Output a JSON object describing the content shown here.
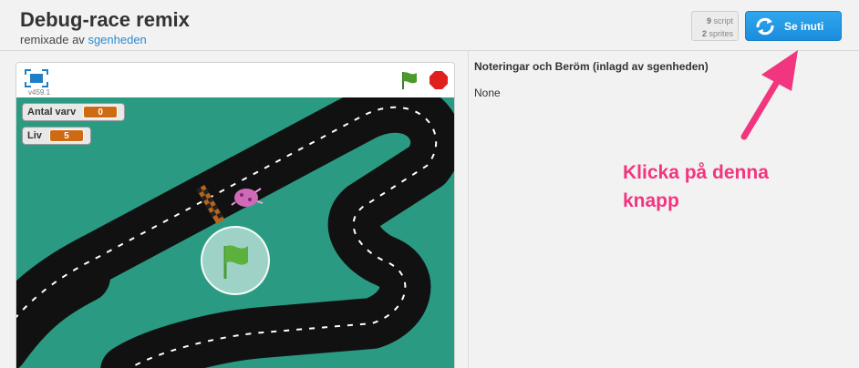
{
  "header": {
    "title": "Debug-race remix",
    "remixed_by_prefix": "remixade av",
    "remixed_by_user": "sgenheden"
  },
  "stats": {
    "scripts_count": "9",
    "scripts_label": "script",
    "sprites_count": "2",
    "sprites_label": "sprites"
  },
  "see_inside": {
    "label": "Se inuti"
  },
  "player": {
    "version": "v459.1",
    "monitors": [
      {
        "label": "Antal varv",
        "value": "0"
      },
      {
        "label": "Liv",
        "value": "5"
      }
    ]
  },
  "notes": {
    "heading": "Noteringar och Beröm (inlagd av sgenheden)",
    "body": "None"
  },
  "annotation": {
    "text_line1": "Klicka på denna",
    "text_line2": "knapp"
  },
  "colors": {
    "accent": "#1a8ddd",
    "stage": "#2a9b82",
    "annotation": "#f2357f",
    "track": "#111111"
  }
}
